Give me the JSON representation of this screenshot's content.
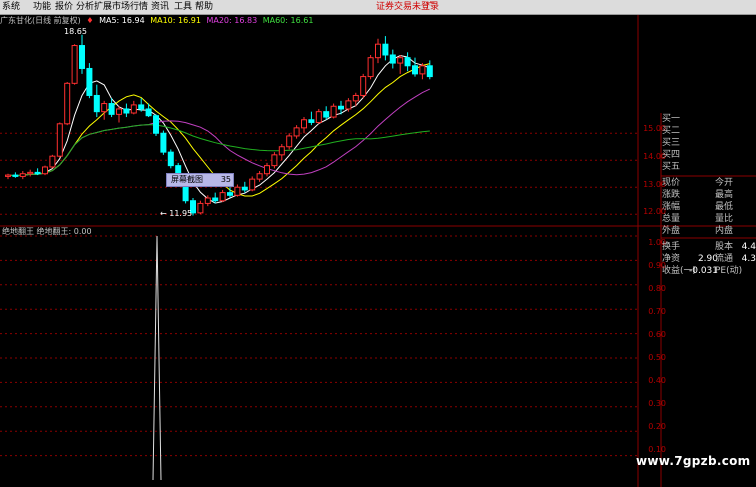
{
  "menu": {
    "items": [
      "系统",
      "功能",
      "报价",
      "分析",
      "扩展市场行情",
      "资讯",
      "工具",
      "帮助"
    ],
    "notice": "证券交易未登录",
    "corner": "广"
  },
  "legend": {
    "title": "广东甘化(日线 前复权)",
    "ma5": "MA5: 16.94",
    "ma10": "MA10: 16.91",
    "ma20": "MA20: 16.83",
    "ma60": "MA60: 16.61"
  },
  "annotations": {
    "high": "18.65",
    "low": "← 11.95"
  },
  "tooltip": {
    "label": "屏幕截图",
    "value": "35"
  },
  "price_axis": {
    "ticks": [
      "15.00",
      "14.00",
      "13.00",
      "12.00"
    ]
  },
  "indicator": {
    "title": "绝地翻王  绝地翻王: 0.00",
    "ticks": [
      "1.00",
      "0.90",
      "0.80",
      "0.70",
      "0.60",
      "0.50",
      "0.40",
      "0.30",
      "0.20",
      "0.10"
    ]
  },
  "quote": {
    "buy": [
      "买一",
      "买二",
      "买三",
      "买四",
      "买五"
    ],
    "rows": [
      {
        "l": "现价",
        "m": "今开"
      },
      {
        "l": "涨跌",
        "m": "最高"
      },
      {
        "l": "涨幅",
        "m": "最低"
      },
      {
        "l": "总量",
        "m": "量比"
      },
      {
        "l": "外盘",
        "m": "内盘"
      }
    ],
    "stats": [
      {
        "l": "换手",
        "v": "",
        "m": "股本",
        "v2": "4.4"
      },
      {
        "l": "净资",
        "v": "2.90",
        "m": "流通",
        "v2": "4.3"
      },
      {
        "l": "收益(一)",
        "v": "-0.031",
        "m": "PE(动)",
        "v2": ""
      }
    ]
  },
  "watermark": "www.7gpzb.com",
  "colors": {
    "bg": "#000000",
    "grid": "#8b0000",
    "up": "#ff3030",
    "down": "#00ffff",
    "ma5": "#ffffff",
    "ma10": "#ffff00",
    "ma20": "#c040c0",
    "ma60": "#20b020"
  },
  "chart_data": {
    "type": "candlestick",
    "price_ylim": [
      11.6,
      18.9
    ],
    "indicator_ylim": [
      0,
      1
    ],
    "indicator_spike": 1.0,
    "candles": [
      [
        13.4,
        13.5,
        13.3,
        13.45
      ],
      [
        13.45,
        13.55,
        13.35,
        13.4
      ],
      [
        13.4,
        13.6,
        13.3,
        13.5
      ],
      [
        13.5,
        13.65,
        13.4,
        13.55
      ],
      [
        13.55,
        13.7,
        13.45,
        13.5
      ],
      [
        13.5,
        13.8,
        13.45,
        13.75
      ],
      [
        13.75,
        14.2,
        13.7,
        14.15
      ],
      [
        14.15,
        15.4,
        14.1,
        15.35
      ],
      [
        15.35,
        16.9,
        15.3,
        16.85
      ],
      [
        16.85,
        18.3,
        16.8,
        18.25
      ],
      [
        18.25,
        18.65,
        17.2,
        17.4
      ],
      [
        17.4,
        17.6,
        16.3,
        16.4
      ],
      [
        16.4,
        16.8,
        15.6,
        15.8
      ],
      [
        15.8,
        16.2,
        15.5,
        16.1
      ],
      [
        16.1,
        16.3,
        15.6,
        15.7
      ],
      [
        15.7,
        16.0,
        15.4,
        15.9
      ],
      [
        15.9,
        16.1,
        15.6,
        15.75
      ],
      [
        15.75,
        16.2,
        15.7,
        16.05
      ],
      [
        16.05,
        16.3,
        15.8,
        15.9
      ],
      [
        15.9,
        16.1,
        15.6,
        15.65
      ],
      [
        15.65,
        15.7,
        14.9,
        15.0
      ],
      [
        15.0,
        15.1,
        14.2,
        14.3
      ],
      [
        14.3,
        14.4,
        13.7,
        13.8
      ],
      [
        13.8,
        13.9,
        13.2,
        13.3
      ],
      [
        13.3,
        13.4,
        12.4,
        12.5
      ],
      [
        12.5,
        12.6,
        11.95,
        12.05
      ],
      [
        12.05,
        12.5,
        12.0,
        12.4
      ],
      [
        12.4,
        12.7,
        12.3,
        12.6
      ],
      [
        12.6,
        12.8,
        12.4,
        12.5
      ],
      [
        12.5,
        12.9,
        12.45,
        12.8
      ],
      [
        12.8,
        13.0,
        12.6,
        12.7
      ],
      [
        12.7,
        13.1,
        12.65,
        13.0
      ],
      [
        13.0,
        13.2,
        12.8,
        12.9
      ],
      [
        12.9,
        13.4,
        12.85,
        13.3
      ],
      [
        13.3,
        13.6,
        13.2,
        13.5
      ],
      [
        13.5,
        13.9,
        13.4,
        13.8
      ],
      [
        13.8,
        14.3,
        13.7,
        14.2
      ],
      [
        14.2,
        14.6,
        14.0,
        14.5
      ],
      [
        14.5,
        15.0,
        14.4,
        14.9
      ],
      [
        14.9,
        15.3,
        14.8,
        15.2
      ],
      [
        15.2,
        15.6,
        15.0,
        15.5
      ],
      [
        15.5,
        15.8,
        15.3,
        15.4
      ],
      [
        15.4,
        15.9,
        15.35,
        15.8
      ],
      [
        15.8,
        16.0,
        15.5,
        15.6
      ],
      [
        15.6,
        16.1,
        15.55,
        16.0
      ],
      [
        16.0,
        16.2,
        15.7,
        15.9
      ],
      [
        15.9,
        16.3,
        15.8,
        16.2
      ],
      [
        16.2,
        16.5,
        16.0,
        16.4
      ],
      [
        16.4,
        17.2,
        16.3,
        17.1
      ],
      [
        17.1,
        17.9,
        17.0,
        17.8
      ],
      [
        17.8,
        18.5,
        17.6,
        18.3
      ],
      [
        18.3,
        18.6,
        17.7,
        17.9
      ],
      [
        17.9,
        18.1,
        17.4,
        17.6
      ],
      [
        17.6,
        17.9,
        17.2,
        17.8
      ],
      [
        17.8,
        18.0,
        17.3,
        17.5
      ],
      [
        17.5,
        17.8,
        17.1,
        17.2
      ],
      [
        17.2,
        17.6,
        17.0,
        17.5
      ],
      [
        17.5,
        17.7,
        17.0,
        17.1
      ]
    ]
  }
}
